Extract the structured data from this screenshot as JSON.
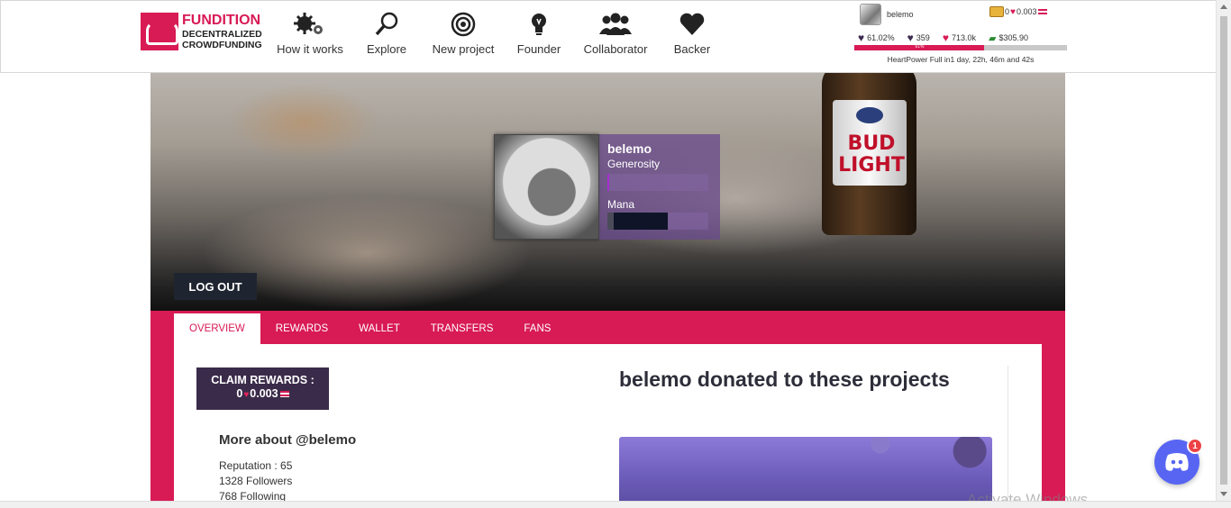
{
  "brand": {
    "title": "FUNDITION",
    "line1": "DECENTRALIZED",
    "line2": "CROWDFUNDING"
  },
  "nav": [
    {
      "label": "How it works",
      "icon": "gears-icon"
    },
    {
      "label": "Explore",
      "icon": "magnifier-icon"
    },
    {
      "label": "New project",
      "icon": "target-icon"
    },
    {
      "label": "Founder",
      "icon": "lightbulb-icon"
    },
    {
      "label": "Collaborator",
      "icon": "people-icon"
    },
    {
      "label": "Backer",
      "icon": "heart-icon"
    }
  ],
  "account": {
    "username": "belemo",
    "wallet_prefix": "0",
    "wallet_value": "0.003",
    "stats": [
      "61.02%",
      "359",
      "713.0k",
      "$305.90"
    ],
    "heartpower_fill": 0.61,
    "bar_label": "61%",
    "heartpower_text": "HeartPower Full in1 day, 22h, 46m and 42s"
  },
  "profile": {
    "name": "belemo",
    "generosity_label": "Generosity",
    "mana_label": "Mana",
    "generosity_fill": 0.02,
    "mana_fill": 0.6
  },
  "logout": "LOG OUT",
  "tabs": [
    "OVERVIEW",
    "REWARDS",
    "WALLET",
    "TRANSFERS",
    "FANS"
  ],
  "claim": {
    "line1": "CLAIM REWARDS :",
    "line2_a": "0",
    "line2_b": "0.003"
  },
  "more": {
    "title": "More about @belemo",
    "reputation": "Reputation : 65",
    "followers": "1328 Followers",
    "following": "768 Following"
  },
  "donated_title": "belemo donated to these projects",
  "watermark": "Activate Windows",
  "discord_badge": "1",
  "colors": {
    "accent": "#d81a55",
    "dark_purple": "#3b2b4a",
    "discord": "#5865f2"
  }
}
